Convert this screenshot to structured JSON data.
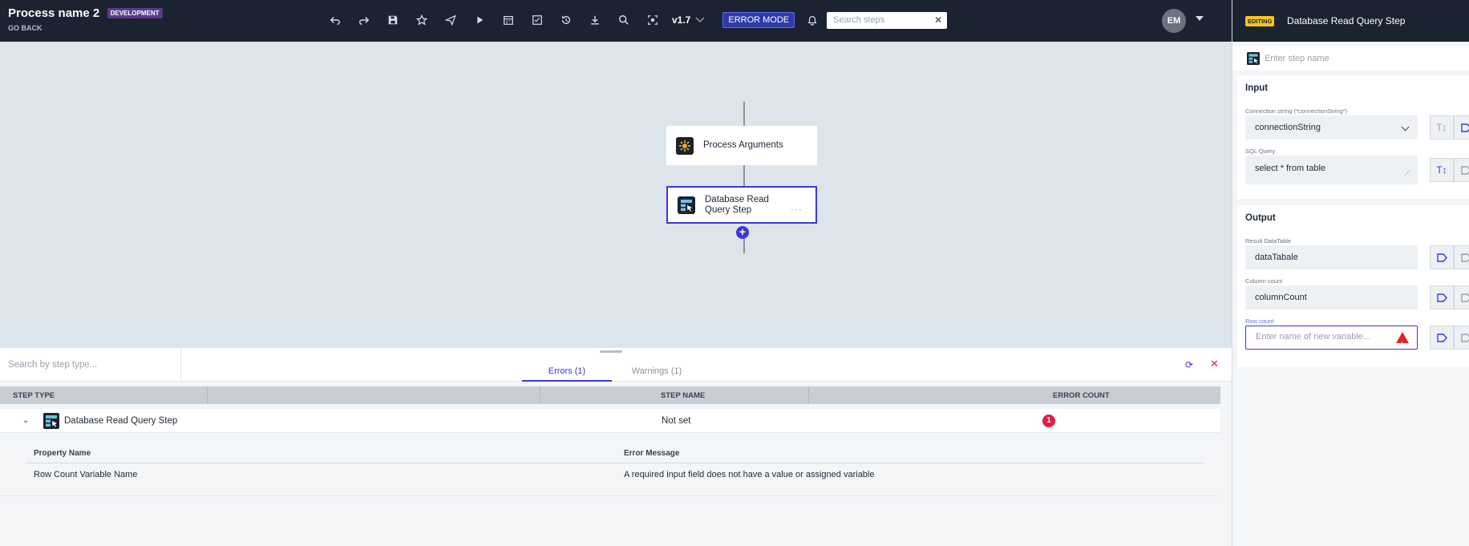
{
  "header": {
    "process_name": "Process name 2",
    "env_badge": "DEVELOPMENT",
    "go_back": "GO BACK",
    "version": "v1.7",
    "error_mode": "ERROR MODE",
    "search_placeholder": "Search steps",
    "avatar_initials": "EM",
    "toolbar_icons": [
      "undo-icon",
      "redo-icon",
      "save-icon",
      "star-icon",
      "send-icon",
      "play-icon",
      "calendar-icon",
      "checklist-icon",
      "history-icon",
      "download-icon",
      "search-icon",
      "focus-icon"
    ]
  },
  "canvas": {
    "nodes": [
      {
        "label": "Process Arguments",
        "icon": "process-arguments-icon",
        "selected": false
      },
      {
        "label": "Database Read Query Step",
        "icon": "database-read-icon",
        "selected": true
      }
    ]
  },
  "bottom_panel": {
    "search_placeholder": "Search by step type...",
    "tabs": [
      {
        "label": "Errors (1)",
        "active": true
      },
      {
        "label": "Warnings (1)",
        "active": false
      }
    ],
    "columns": [
      "STEP TYPE",
      "STEP NAME",
      "ERROR COUNT"
    ],
    "rows": [
      {
        "step_type": "Database Read Query Step",
        "step_name": "Not set",
        "error_count": "1",
        "details": {
          "columns": [
            "Property Name",
            "Error Message"
          ],
          "rows": [
            {
              "property": "Row Count Variable Name",
              "message": "A required input field does not have a value or assigned variable"
            }
          ]
        }
      }
    ]
  },
  "right_panel": {
    "editing_badge": "EDITING",
    "title": "Database Read Query Step",
    "step_name_placeholder": "Enter step name",
    "input_section": {
      "title": "Input",
      "fields": [
        {
          "label": "Connection string (*connectionString*)",
          "value": "connectionString"
        },
        {
          "label": "SQL Query",
          "value": "select * from table"
        }
      ]
    },
    "output_section": {
      "title": "Output",
      "fields": [
        {
          "label": "Result DataTable",
          "value": "dataTabale"
        },
        {
          "label": "Column count",
          "value": "columnCount"
        },
        {
          "label": "Row count",
          "placeholder": "Enter name of new variable..."
        }
      ]
    }
  },
  "colors": {
    "accent": "#3c37d8",
    "error": "#e11d48",
    "topbar": "#1b2230",
    "canvas": "#dde5ec"
  }
}
